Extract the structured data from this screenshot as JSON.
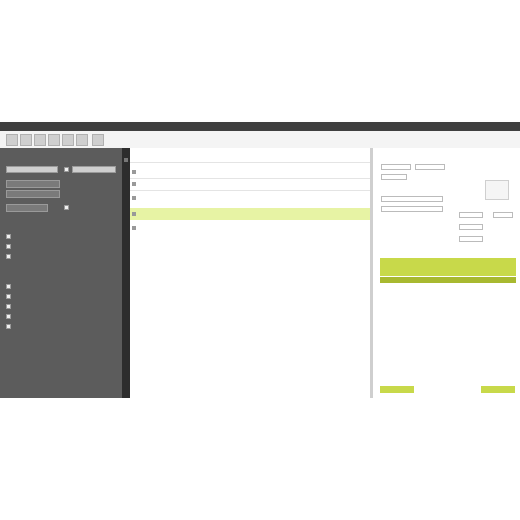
{
  "window": {
    "title": "",
    "right_text": ""
  },
  "sidebar": {
    "search_label": "",
    "field_value": "",
    "options_label": "",
    "checkbox_label": "",
    "list_a_title": "",
    "list_a": [
      "",
      "",
      ""
    ],
    "list_b_title": "",
    "list_b": [
      "",
      "",
      "",
      "",
      ""
    ],
    "footer": ""
  },
  "list": {
    "header": "",
    "rows": [
      [
        "",
        "",
        "",
        ""
      ],
      [
        "",
        "",
        "",
        ""
      ],
      [
        "",
        "",
        "",
        ""
      ],
      [
        "",
        "",
        "",
        ""
      ],
      [
        "",
        "",
        "",
        ""
      ]
    ]
  },
  "detail": {
    "header": "",
    "btn_left": "",
    "btn_right": ""
  },
  "colors": {
    "sidebar_bg": "#5c5c5c",
    "selection": "#e7f3a4",
    "accent": "#c8d94a"
  },
  "icons": [
    "checkbox-icon",
    "list-row-icon",
    "toolbar-button-icon"
  ]
}
